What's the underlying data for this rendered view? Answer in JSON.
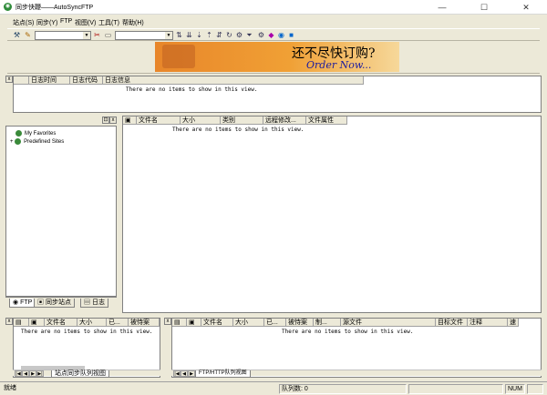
{
  "window": {
    "title": "同步快鞭——AutoSyncFTP",
    "minimize": "—",
    "maximize": "☐",
    "close": "✕"
  },
  "menu": [
    "站点(S)",
    "同步(Y)",
    "FTP",
    "视图(V)",
    "工具(T)",
    "帮助(H)"
  ],
  "ad": {
    "cn": "还不尽快订购?",
    "en": "Order Now..."
  },
  "log": {
    "columns": [
      "日志时间",
      "日志代码",
      "日志信息"
    ],
    "empty": "There are no items to show in this view."
  },
  "tree": {
    "items": [
      "My Favorites",
      "Predefined Sites"
    ]
  },
  "left_tabs": [
    "FTP",
    "同步站点",
    "日志"
  ],
  "files": {
    "columns": [
      "文件名",
      "大小",
      "类别",
      "远程修改...",
      "文件属性"
    ],
    "empty": "There are no items to show in this view."
  },
  "sync_queue": {
    "columns": [
      "文件名",
      "大小",
      "已...",
      "被恃案"
    ],
    "empty": "There are no items to show in this view.",
    "tab": "站点同步队列视图"
  },
  "ftp_queue": {
    "columns": [
      "文件名",
      "大小",
      "已...",
      "被恃案",
      "制...",
      "源文件",
      "目标文件",
      "注释",
      "速"
    ],
    "empty": "There are no items to show in this view.",
    "tab": "FTP/HTTP队列视图"
  },
  "status": {
    "ready": "就绪",
    "queue": "队列数: 0",
    "num": "NUM"
  }
}
